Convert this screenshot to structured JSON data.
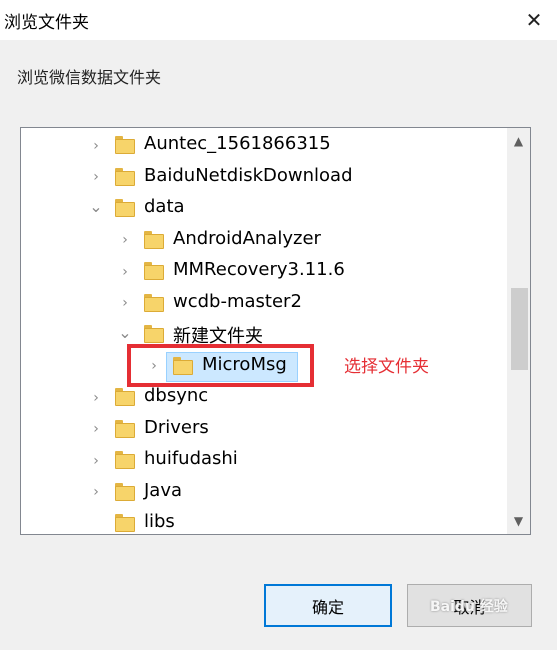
{
  "window": {
    "title": "浏览文件夹",
    "close_glyph": "✕"
  },
  "description": "浏览微信数据文件夹",
  "tree": {
    "items": [
      {
        "label": "Auntec_1561866315",
        "arrow": "›",
        "level": 0
      },
      {
        "label": "BaiduNetdiskDownload",
        "arrow": "›",
        "level": 0
      },
      {
        "label": "data",
        "arrow": "⌄",
        "level": 0
      },
      {
        "label": "AndroidAnalyzer",
        "arrow": "›",
        "level": 1
      },
      {
        "label": "MMRecovery3.11.6",
        "arrow": "›",
        "level": 1
      },
      {
        "label": "wcdb-master2",
        "arrow": "›",
        "level": 1
      },
      {
        "label": "新建文件夹",
        "arrow": "⌄",
        "level": 1
      },
      {
        "label": "MicroMsg",
        "arrow": "›",
        "level": 2,
        "selected": true
      },
      {
        "label": "dbsync",
        "arrow": "›",
        "level": 0
      },
      {
        "label": "Drivers",
        "arrow": "›",
        "level": 0
      },
      {
        "label": "huifudashi",
        "arrow": "›",
        "level": 0
      },
      {
        "label": "Java",
        "arrow": "›",
        "level": 0
      },
      {
        "label": "libs",
        "arrow": "",
        "level": 0
      }
    ]
  },
  "scrollbar": {
    "up_glyph": "▲",
    "down_glyph": "▼"
  },
  "annotation": "选择文件夹",
  "buttons": {
    "ok": "确定",
    "cancel": "取消"
  },
  "watermark": "Baidu 经验"
}
